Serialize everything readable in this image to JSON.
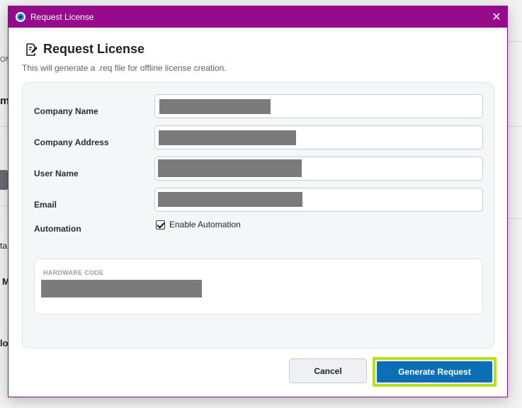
{
  "window": {
    "title": "Request License",
    "close_glyph": "✕"
  },
  "background": {
    "fragments": [
      "ON",
      "m",
      "ta",
      "M",
      "lo"
    ]
  },
  "dialog": {
    "heading": "Request License",
    "subtitle": "This will generate a .req file for offline license creation.",
    "fields": [
      {
        "label": "Company Name",
        "value": ""
      },
      {
        "label": "Company Address",
        "value": ""
      },
      {
        "label": "User Name",
        "value": ""
      },
      {
        "label": "Email",
        "value": ""
      }
    ],
    "automation": {
      "label": "Automation",
      "checkbox_label": "Enable Automation",
      "checked": true
    },
    "hardware_code": {
      "label": "HARDWARE CODE",
      "value": ""
    },
    "buttons": {
      "cancel": "Cancel",
      "generate": "Generate Request"
    }
  },
  "colors": {
    "titlebar": "#960a8c",
    "primary": "#0a6fb5",
    "focus_outline": "#b6e017"
  },
  "icons": {
    "app": "app-logo-icon",
    "heading": "edit-document-icon",
    "close": "close-icon",
    "checkbox": "checkmark-icon"
  }
}
